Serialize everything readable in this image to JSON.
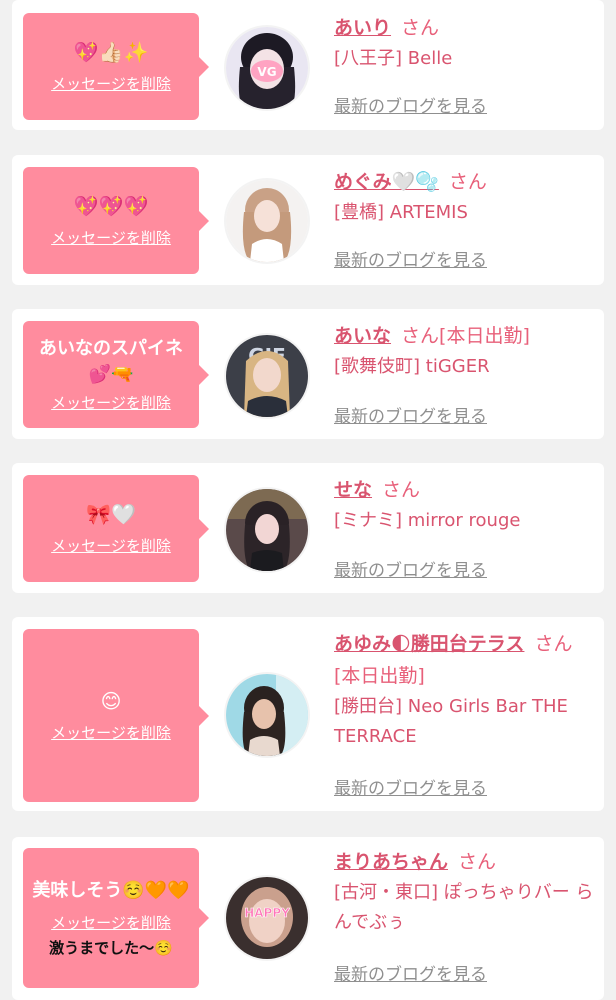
{
  "delete_label": "メッセージを削除",
  "blog_label": "最新のブログを見る",
  "cards": [
    {
      "message": "💖👍🏻✨",
      "name": "あいり",
      "san": "さん",
      "status": "",
      "shop": "[八王子] Belle"
    },
    {
      "message": "💖💖💖",
      "name": "めぐみ🤍🫧",
      "san": "さん",
      "status": "",
      "shop": "[豊橋] ARTEMIS"
    },
    {
      "message": "あいなのスパイネ💕🔫",
      "name": "あいな",
      "san": "さん",
      "status": "[本日出勤]",
      "shop": "[歌舞伎町] tiGGER"
    },
    {
      "message": "🎀🤍",
      "name": "せな",
      "san": "さん",
      "status": "",
      "shop": "[ミナミ] mirror rouge"
    },
    {
      "message": "😊",
      "name": "あゆみ🌓勝田台テラス",
      "san": "さん",
      "status": "[本日出勤]",
      "shop": "[勝田台] Neo Girls Bar THE TERRACE"
    },
    {
      "message": "美味しそう☺️🧡🧡",
      "name": "まりあちゃん",
      "san": "さん",
      "status": "",
      "shop": "[古河・東口] ぽっちゃりバー らんでぶぅ",
      "extra": "激うまでした〜☺️"
    }
  ],
  "avatar_texts": {
    "card1": "VG",
    "card3": "GIE",
    "card6": "HAPPY"
  }
}
